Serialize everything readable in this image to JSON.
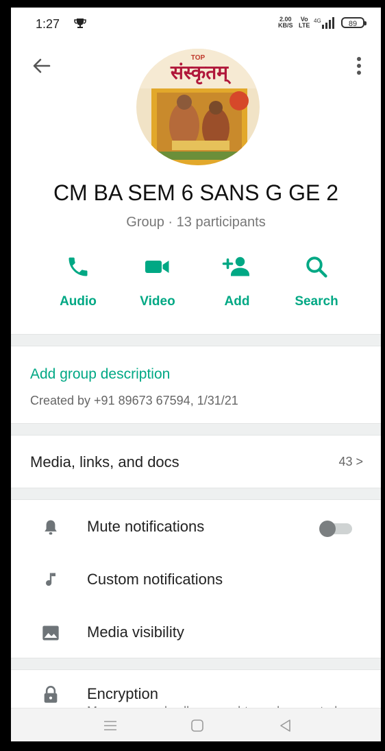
{
  "status_bar": {
    "time": "1:27",
    "speed_top": "2.00",
    "speed_bottom": "KB/S",
    "volte_top": "Vo",
    "volte_bottom": "LTE",
    "network": "4G",
    "battery": "89"
  },
  "header": {
    "back_icon": "arrow-left",
    "more_icon": "more-vertical",
    "avatar_text": "संस्कृतम्"
  },
  "group": {
    "name": "CM BA SEM 6 SANS G GE 2",
    "subtitle": "Group · 13 participants"
  },
  "actions": [
    {
      "label": "Audio",
      "icon": "phone-icon"
    },
    {
      "label": "Video",
      "icon": "video-camera-icon"
    },
    {
      "label": "Add",
      "icon": "add-person-icon"
    },
    {
      "label": "Search",
      "icon": "search-icon"
    }
  ],
  "description": {
    "link": "Add group description",
    "created": "Created by +91 89673 67594, 1/31/21"
  },
  "media": {
    "label": "Media, links, and docs",
    "count": "43 >"
  },
  "settings": [
    {
      "label": "Mute notifications",
      "icon": "bell-icon",
      "toggle": false
    },
    {
      "label": "Custom notifications",
      "icon": "music-note-icon"
    },
    {
      "label": "Media visibility",
      "icon": "image-icon"
    }
  ],
  "encryption": {
    "label": "Encryption",
    "sub": "Messages and calls are end-to-end encrypted",
    "icon": "lock-icon"
  },
  "accent_color": "#00a884"
}
